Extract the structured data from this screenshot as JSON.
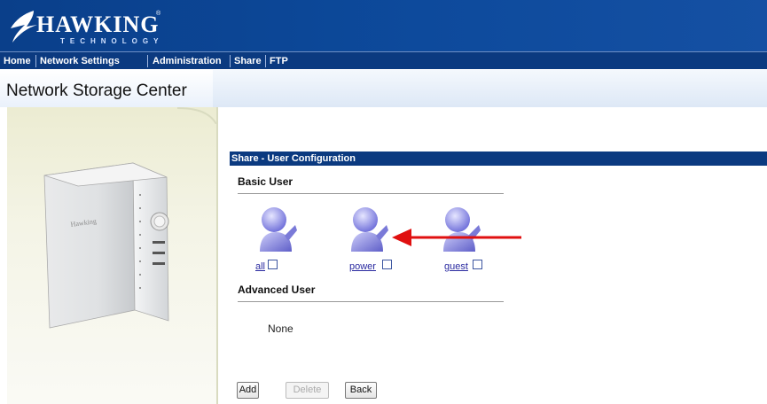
{
  "header": {
    "logo_text": "HAWKING",
    "logo_reg": "®",
    "logo_sub": "TECHNOLOGY"
  },
  "nav": {
    "items": [
      "Home",
      "Network Settings",
      "Administration",
      "Share",
      "FTP"
    ]
  },
  "banner": {
    "title": "Network Storage Center"
  },
  "panel": {
    "title": "Share - User Configuration",
    "basic_title": "Basic User",
    "advanced_title": "Advanced User",
    "users": [
      {
        "name": "all"
      },
      {
        "name": "power"
      },
      {
        "name": "guest"
      }
    ],
    "advanced_none": "None"
  },
  "buttons": {
    "add": "Add",
    "delete": "Delete",
    "back": "Back"
  },
  "colors": {
    "nav_bg": "#0b3a80",
    "annotation_arrow": "#e01010",
    "user_icon": "#7f7fe6"
  }
}
